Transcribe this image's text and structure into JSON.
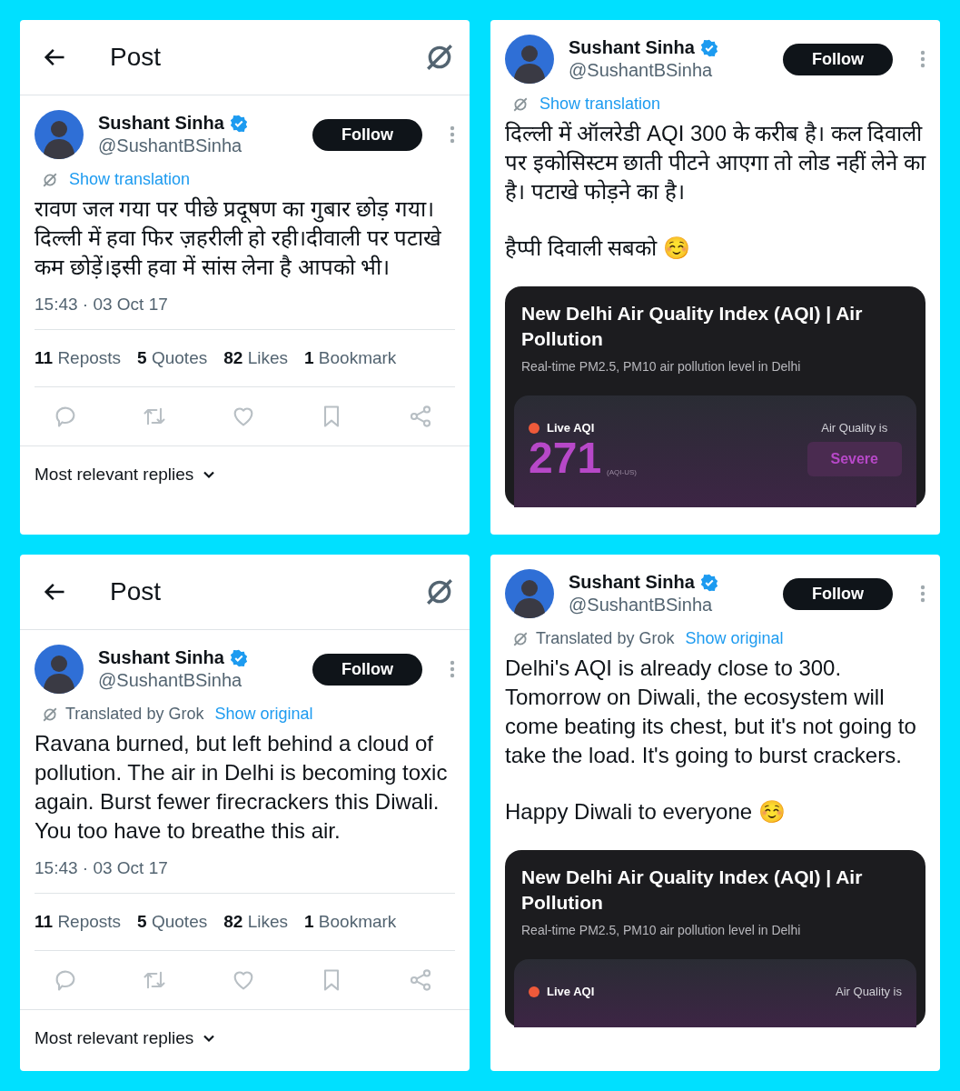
{
  "panels": [
    {
      "kind": "post_detail",
      "header": {
        "title": "Post"
      },
      "author": {
        "name": "Sushant Sinha",
        "handle": "@SushantBSinha",
        "follow": "Follow"
      },
      "translation": {
        "link": "Show translation"
      },
      "paragraphs": [
        "रावण जल गया पर पीछे प्रदूषण का गुबार छोड़ गया। दिल्ली में हवा फिर ज़हरीली हो रही।दीवाली पर पटाखे कम छोड़ें।इसी हवा में सांस लेना है आपको भी।"
      ],
      "timestamp": "15:43 · 03 Oct 17",
      "stats": [
        {
          "count": "11",
          "label": "Reposts"
        },
        {
          "count": "5",
          "label": "Quotes"
        },
        {
          "count": "82",
          "label": "Likes"
        },
        {
          "count": "1",
          "label": "Bookmark"
        }
      ],
      "sort": "Most relevant replies"
    },
    {
      "kind": "post_continuation",
      "author": {
        "name": "Sushant Sinha",
        "handle": "@SushantBSinha",
        "follow": "Follow"
      },
      "translation": {
        "link": "Show translation"
      },
      "paragraphs": [
        "दिल्ली में ऑलरेडी AQI 300 के करीब है। कल दिवाली पर इकोसिस्टम छाती पीटने आएगा तो लोड नहीं लेने का है। पटाखे फोड़ने का है।",
        "हैप्पी दिवाली सबको ☺️"
      ],
      "card": {
        "title": "New Delhi Air Quality Index (AQI) | Air Pollution",
        "subtitle": "Real-time PM2.5, PM10 air pollution level in Delhi",
        "live": "Live AQI",
        "value": "271",
        "unit": "(AQI-US)",
        "quality_label": "Air Quality is",
        "quality": "Severe"
      }
    },
    {
      "kind": "post_detail",
      "header": {
        "title": "Post"
      },
      "author": {
        "name": "Sushant Sinha",
        "handle": "@SushantBSinha",
        "follow": "Follow"
      },
      "translation": {
        "label": "Translated by Grok",
        "link": "Show original"
      },
      "paragraphs": [
        "Ravana burned, but left behind a cloud of pollution. The air in Delhi is becoming toxic again. Burst fewer firecrackers this Diwali. You too have to breathe this air."
      ],
      "timestamp": "15:43 · 03 Oct 17",
      "stats": [
        {
          "count": "11",
          "label": "Reposts"
        },
        {
          "count": "5",
          "label": "Quotes"
        },
        {
          "count": "82",
          "label": "Likes"
        },
        {
          "count": "1",
          "label": "Bookmark"
        }
      ],
      "sort": "Most relevant replies"
    },
    {
      "kind": "post_continuation",
      "author": {
        "name": "Sushant Sinha",
        "handle": "@SushantBSinha",
        "follow": "Follow"
      },
      "translation": {
        "label": "Translated by Grok",
        "link": "Show original"
      },
      "paragraphs": [
        "Delhi's AQI is already close to 300. Tomorrow on Diwali, the ecosystem will come beating its chest, but it's not going to take the load. It's going to burst crackers.",
        "Happy Diwali to everyone ☺️"
      ],
      "card": {
        "title": "New Delhi Air Quality Index (AQI) | Air Pollution",
        "subtitle": "Real-time PM2.5, PM10 air pollution level in Delhi",
        "live": "Live AQI",
        "quality_label": "Air Quality is"
      }
    }
  ]
}
